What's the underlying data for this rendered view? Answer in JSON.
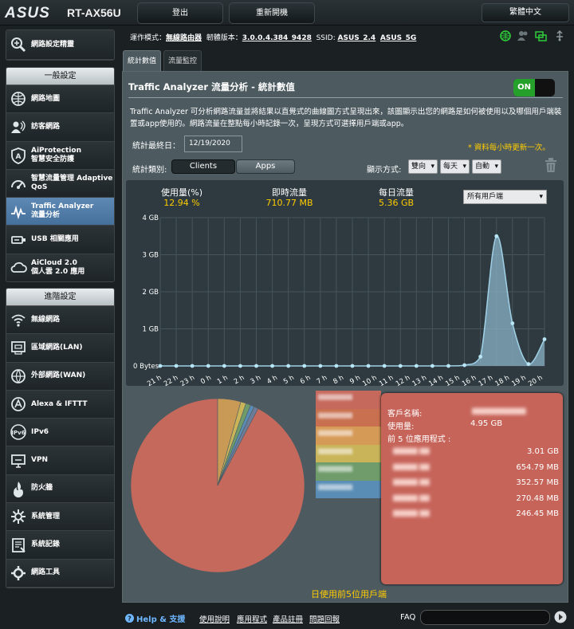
{
  "header": {
    "logo": "ASUS",
    "model": "RT-AX56U",
    "logout_label": "登出",
    "reboot_label": "重新開機",
    "language": "繁體中文"
  },
  "status": {
    "mode_label": "運作模式：",
    "mode_value": "無線路由器",
    "fw_label": "韌體版本：",
    "fw_value": "3.0.0.4.384_9428",
    "ssid_label": "SSID:",
    "ssid_1": "ASUS_2.4",
    "ssid_2": "ASUS_5G"
  },
  "sidebar": {
    "setup_wizard": "網路設定精靈",
    "general_heading": "一般設定",
    "general_items": [
      {
        "label": "網路地圖",
        "icon": "network-map-icon"
      },
      {
        "label": "訪客網路",
        "icon": "guest-network-icon"
      },
      {
        "label": "AiProtection\n智慧安全防護",
        "icon": "aiprotection-icon"
      },
      {
        "label": "智慧流量管理 Adaptive QoS",
        "icon": "adaptive-qos-icon"
      },
      {
        "label": "Traffic Analyzer\n流量分析",
        "icon": "traffic-analyzer-icon"
      },
      {
        "label": "USB 相關應用",
        "icon": "usb-icon"
      },
      {
        "label": "AiCloud 2.0\n個人雲 2.0 應用",
        "icon": "aicloud-icon"
      }
    ],
    "advanced_heading": "進階設定",
    "advanced_items": [
      {
        "label": "無線網路",
        "icon": "wireless-icon"
      },
      {
        "label": "區域網路(LAN)",
        "icon": "lan-icon"
      },
      {
        "label": "外部網路(WAN)",
        "icon": "wan-icon"
      },
      {
        "label": "Alexa & IFTTT",
        "icon": "alexa-icon"
      },
      {
        "label": "IPv6",
        "icon": "ipv6-icon"
      },
      {
        "label": "VPN",
        "icon": "vpn-icon"
      },
      {
        "label": "防火牆",
        "icon": "firewall-icon"
      },
      {
        "label": "系統管理",
        "icon": "administration-icon"
      },
      {
        "label": "系統記錄",
        "icon": "system-log-icon"
      },
      {
        "label": "網路工具",
        "icon": "network-tools-icon"
      }
    ]
  },
  "tabs": {
    "statistic": "統計數值",
    "monitor": "流量監控"
  },
  "content": {
    "title": "Traffic Analyzer 流量分析 - 統計數值",
    "toggle": "ON",
    "description": "Traffic Analyzer 可分析網路流量並將結果以直覺式的曲線圖方式呈現出來，該圖顯示出您的網路是如何被使用以及哪個用戶端裝置或app使用的。網路流量在整點每小時記錄一次，呈現方式可選擇用戶端或app。",
    "date_label": "統計最終日：",
    "date_value": "12/19/2020",
    "update_note": "* 資料每小時更新一次。",
    "category_label": "統計類別:",
    "btn_clients": "Clients",
    "btn_apps": "Apps",
    "display_label": "顯示方式:",
    "sel_direction": "雙向",
    "sel_period": "每天",
    "sel_scale": "自動"
  },
  "stats": {
    "usage_label": "使用量(%)",
    "usage_value": "12.94 %",
    "realtime_label": "即時流量",
    "realtime_value": "710.77 MB",
    "daily_label": "每日流量",
    "daily_value": "5.36 GB",
    "client_select": "所有用戶端"
  },
  "chart_data": {
    "type": "area",
    "x": [
      "21 h",
      "22 h",
      "23 h",
      "0 h",
      "1 h",
      "2 h",
      "3 h",
      "4 h",
      "5 h",
      "6 h",
      "7 h",
      "8 h",
      "9 h",
      "10 h",
      "11 h",
      "12 h",
      "13 h",
      "14 h",
      "15 h",
      "16 h",
      "17 h",
      "18 h",
      "19 h",
      "20 h"
    ],
    "values_gb": [
      0,
      0,
      0,
      0,
      0,
      0,
      0,
      0,
      0,
      0,
      0,
      0,
      0,
      0,
      0,
      0,
      0,
      0,
      0,
      0.02,
      0.25,
      3.5,
      1.15,
      0.05,
      0.72
    ],
    "ylim": [
      0,
      4
    ],
    "yticks": [
      "0 Bytes",
      "1 GB",
      "2 GB",
      "3 GB",
      "4 GB"
    ],
    "grid": true,
    "colors": {
      "area": "#8ab3c8",
      "line": "#9fd0e6",
      "point": "#b9e6f7"
    }
  },
  "pie": {
    "caption": "日使用前5位用戶端",
    "slices": [
      {
        "value": 92.3,
        "color": "#c5695c"
      },
      {
        "value": 4.3,
        "color": "#c89a55"
      },
      {
        "value": 1.0,
        "color": "#c9b45a"
      },
      {
        "value": 0.9,
        "color": "#6f9c6a"
      },
      {
        "value": 0.7,
        "color": "#5a8db5"
      },
      {
        "value": 0.8,
        "color": "#6e7c99"
      }
    ],
    "legend_colors": [
      "#c5695c",
      "#c8704f",
      "#d69a57",
      "#c9b45a",
      "#6f9c6a",
      "#5a8db5"
    ]
  },
  "card": {
    "client_label": "客戶名稱:",
    "usage_label": "使用量:",
    "usage_value": "4.95 GB",
    "top_apps_label": "前 5 位應用程式 :",
    "apps": [
      {
        "value": "3.01 GB"
      },
      {
        "value": "654.79 MB"
      },
      {
        "value": "352.57 MB"
      },
      {
        "value": "270.48 MB"
      },
      {
        "value": "246.45 MB"
      }
    ]
  },
  "footer": {
    "help": "Help & 支援",
    "manual": "使用說明",
    "utility": "應用程式",
    "register": "產品註冊",
    "feedback": "問題回報",
    "faq": "FAQ"
  }
}
